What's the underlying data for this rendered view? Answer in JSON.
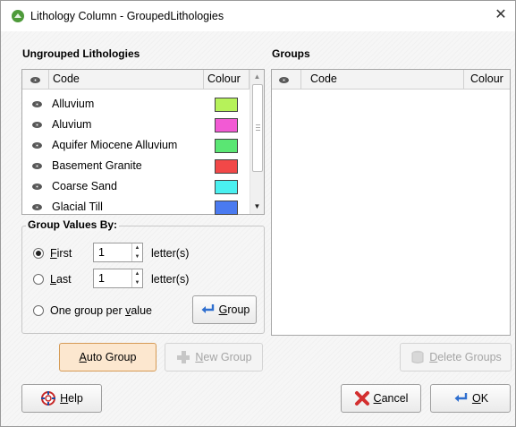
{
  "window": {
    "title": "Lithology Column - GroupedLithologies",
    "close_glyph": "✕"
  },
  "ungrouped": {
    "label": "Ungrouped Lithologies",
    "headers": {
      "code": "Code",
      "colour": "Colour"
    },
    "rows": [
      {
        "code": "Alluvium",
        "colour": "#b6f25a"
      },
      {
        "code": "Aluvium",
        "colour": "#f25ad4"
      },
      {
        "code": "Aquifer Miocene Alluvium",
        "colour": "#5ae673"
      },
      {
        "code": "Basement Granite",
        "colour": "#f24848"
      },
      {
        "code": "Coarse Sand",
        "colour": "#4af0f0"
      },
      {
        "code": "Glacial Till",
        "colour": "#4a7af0"
      }
    ]
  },
  "groups": {
    "label": "Groups",
    "headers": {
      "code": "Code",
      "colour": "Colour"
    }
  },
  "group_values": {
    "label": "Group Values By:",
    "first": {
      "label_mnemonic": "F",
      "label_rest": "irst",
      "value": "1",
      "suffix": "letter(s)",
      "selected": true
    },
    "last": {
      "label_mnemonic": "L",
      "label_rest": "ast",
      "value": "1",
      "suffix": "letter(s)",
      "selected": false
    },
    "one_per_value": {
      "label_prefix": "One group per ",
      "label_mnemonic": "v",
      "label_rest": "alue",
      "selected": false
    },
    "group_button": {
      "mnemonic": "G",
      "rest": "roup"
    }
  },
  "buttons": {
    "auto_group": {
      "mnemonic": "A",
      "rest": "uto Group"
    },
    "new_group": {
      "mnemonic": "N",
      "rest": "ew Group"
    },
    "delete_groups": {
      "mnemonic": "D",
      "rest": "elete Groups"
    },
    "help": {
      "mnemonic": "H",
      "rest": "elp"
    },
    "cancel": {
      "mnemonic": "C",
      "rest": "ancel"
    },
    "ok": {
      "mnemonic": "O",
      "rest": "K"
    }
  },
  "colors": {
    "accent": "#fce7cf",
    "accent_border": "#d59a55",
    "app_icon": "#4e9a3a"
  },
  "icons": {
    "app": "leapfrog-icon",
    "visibility": "eye-icon",
    "group": "arrow-return-icon",
    "new_group": "plus-icon",
    "delete": "trash-icon",
    "help": "lifebuoy-icon",
    "cancel": "red-x-icon",
    "ok": "arrow-return-icon"
  }
}
